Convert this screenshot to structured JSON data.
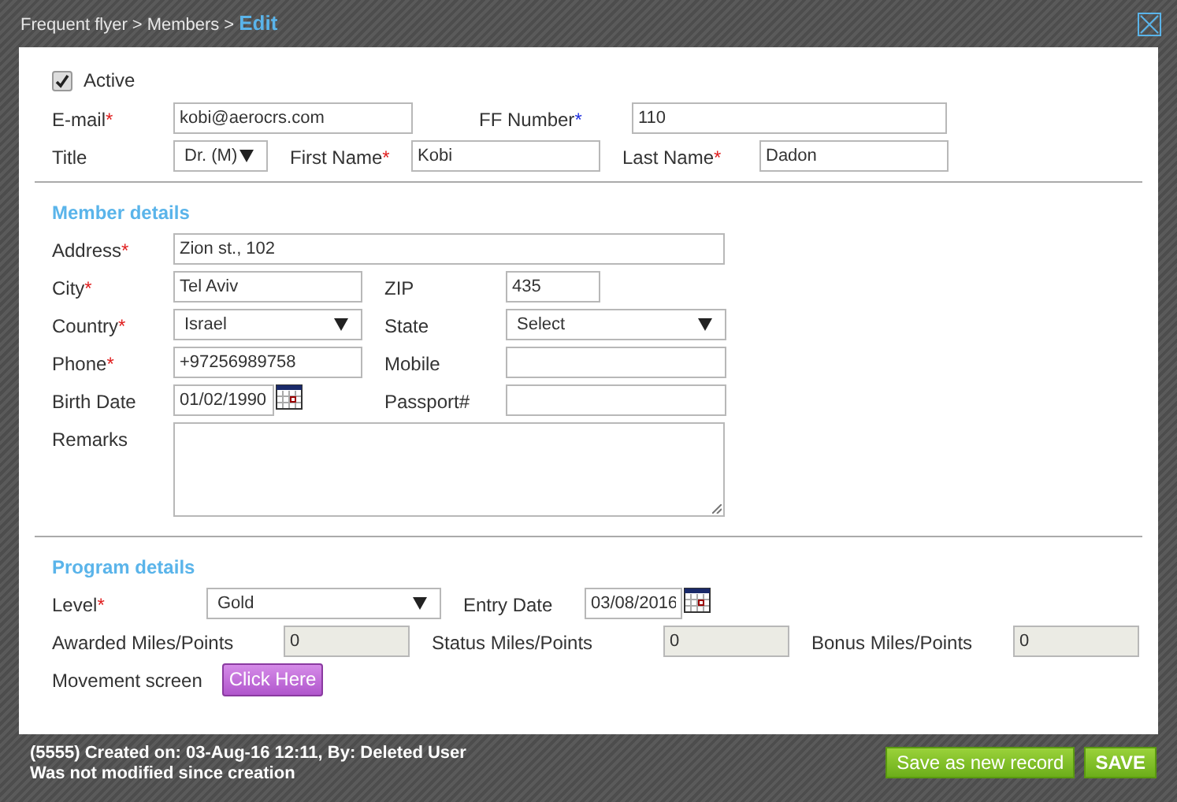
{
  "header": {
    "breadcrumb": [
      "Frequent flyer",
      ">",
      "Members",
      ">"
    ],
    "current": "Edit"
  },
  "active": {
    "label": "Active",
    "checked": true
  },
  "sections": [
    {
      "rows": [
        [
          {
            "kind": "text",
            "label": "E-mail",
            "mark": {
              "text": "*",
              "color": "#e02020"
            },
            "value": "kobi@aerocrs.com"
          },
          {
            "kind": "text",
            "label": "FF Number",
            "mark": {
              "text": "*",
              "color": "#2030e0"
            },
            "value": "110"
          }
        ],
        [
          {
            "kind": "select",
            "label": "Title",
            "value": "Dr. (M)"
          },
          {
            "kind": "text",
            "label": "First Name",
            "mark": {
              "text": "*",
              "color": "#e02020"
            },
            "value": "Kobi"
          },
          {
            "kind": "text",
            "label": "Last Name",
            "mark": {
              "text": "*",
              "color": "#e02020"
            },
            "value": "Dadon"
          }
        ]
      ]
    },
    {
      "title": "Member details",
      "rows": [
        [
          {
            "kind": "text",
            "label": "Address",
            "mark": {
              "text": "*",
              "color": "#e02020"
            },
            "value": "Zion st., 102"
          }
        ],
        [
          {
            "kind": "text",
            "label": "City",
            "mark": {
              "text": "*",
              "color": "#e02020"
            },
            "value": "Tel Aviv"
          },
          {
            "kind": "text",
            "label": "ZIP",
            "value": "435"
          }
        ],
        [
          {
            "kind": "select",
            "label": "Country",
            "mark": {
              "text": "*",
              "color": "#e02020"
            },
            "value": "Israel"
          },
          {
            "kind": "select",
            "label": "State",
            "value": "Select"
          }
        ],
        [
          {
            "kind": "text",
            "label": "Phone",
            "mark": {
              "text": "*",
              "color": "#e02020"
            },
            "value": "+97256989758"
          },
          {
            "kind": "text",
            "label": "Mobile"
          }
        ],
        [
          {
            "kind": "date",
            "label": "Birth Date",
            "value": "01/02/1990"
          },
          {
            "kind": "text",
            "label": "Passport#"
          }
        ],
        [
          {
            "kind": "textarea",
            "label": "Remarks"
          }
        ]
      ]
    },
    {
      "title": "Program details",
      "rows": [
        [
          {
            "kind": "select",
            "label": "Level",
            "mark": {
              "text": "*",
              "color": "#e02020"
            },
            "value": "Gold"
          },
          {
            "kind": "date",
            "label": "Entry Date",
            "value": "03/08/2016"
          }
        ],
        [
          {
            "kind": "readonly",
            "label": "Awarded Miles/Points",
            "value": "0"
          },
          {
            "kind": "readonly",
            "label": "Status Miles/Points",
            "value": "0"
          },
          {
            "kind": "readonly",
            "label": "Bonus Miles/Points",
            "value": "0"
          }
        ],
        [
          {
            "kind": "button",
            "label": "Movement screen",
            "value": "Click Here"
          }
        ]
      ]
    }
  ],
  "footer": {
    "info": [
      "(5555) Created on: 03-Aug-16 12:11, By: Deleted User",
      "Was not modified since creation"
    ],
    "buttons": [
      "Save as new record",
      "SAVE"
    ]
  }
}
